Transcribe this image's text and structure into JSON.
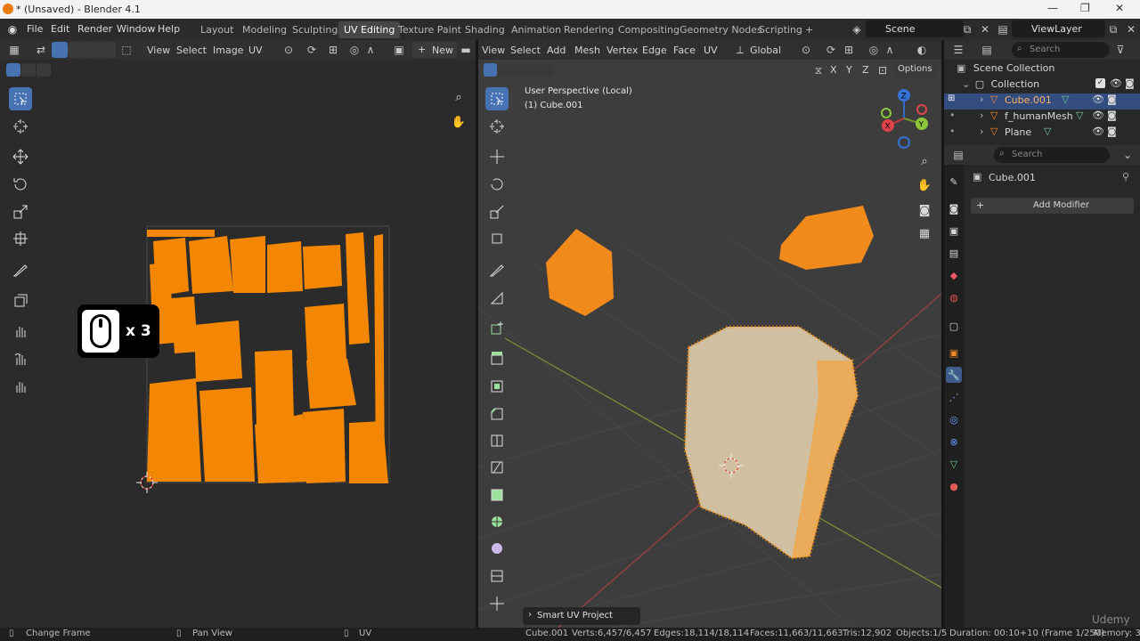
{
  "window": {
    "title": "* (Unsaved) - Blender 4.1",
    "controls": [
      "—",
      "❐",
      "✕"
    ]
  },
  "menu": [
    "File",
    "Edit",
    "Render",
    "Window",
    "Help"
  ],
  "workspaces": [
    "Layout",
    "Modeling",
    "Sculpting",
    "UV Editing",
    "Texture Paint",
    "Shading",
    "Animation",
    "Rendering",
    "Compositing",
    "Geometry Nodes",
    "Scripting",
    "+"
  ],
  "active_workspace": "UV Editing",
  "scene_field": "Scene",
  "viewlayer_field": "ViewLayer",
  "uv_header": {
    "menus": [
      "View",
      "Select",
      "Image",
      "UV"
    ],
    "new_label": "New"
  },
  "overlay": {
    "clicks": "x 3"
  },
  "viewport_header": {
    "menus": [
      "View",
      "Select",
      "Add",
      "Mesh",
      "Vertex",
      "Edge",
      "Face",
      "UV"
    ],
    "orientation": "Global",
    "axes": [
      "X",
      "Y",
      "Z"
    ],
    "options_label": "Options"
  },
  "viewport_info": {
    "line1": "User Perspective (Local)",
    "line2": "(1) Cube.001"
  },
  "gizmo": {
    "x": "X",
    "y": "Y",
    "z": "Z"
  },
  "operator_panel": "Smart UV Project",
  "outliner": {
    "search_placeholder": "Search",
    "scene_collection": "Scene Collection",
    "collection": "Collection",
    "items": [
      "Cube.001",
      "f_humanMesh",
      "Plane"
    ]
  },
  "properties": {
    "search_placeholder": "Search",
    "object_name": "Cube.001",
    "add_modifier": "Add Modifier"
  },
  "status": {
    "left1": "Change Frame",
    "left2": "Pan View",
    "left3": "UV",
    "object": "Cube.001",
    "verts": "Verts:6,457/6,457",
    "edges": "Edges:18,114/18,114",
    "faces": "Faces:11,663/11,663",
    "tris": "Tris:12,902",
    "objects": "Objects:1/5",
    "duration": "Duration: 00:10+10 (Frame 1/250)",
    "memory": "Memory: 3"
  },
  "watermark": "Udemy",
  "colors": {
    "accent": "#4772b3",
    "selection": "#ff8c00",
    "header": "#303030",
    "viewport_bg": "#3d3d3d"
  }
}
